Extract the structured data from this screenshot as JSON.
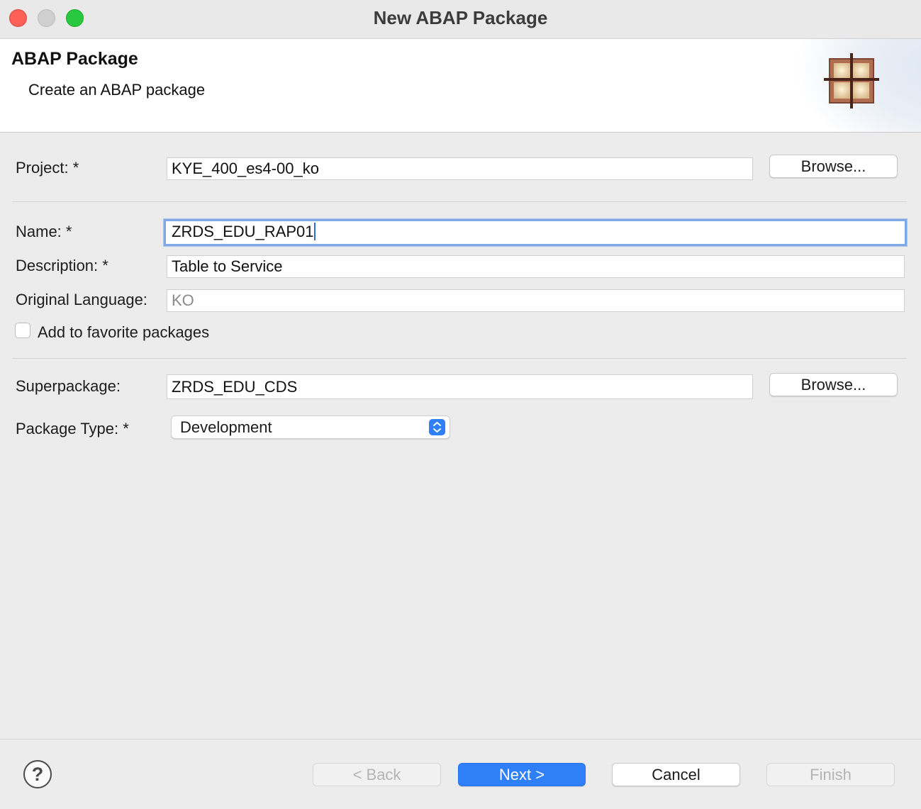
{
  "window": {
    "title": "New ABAP Package"
  },
  "header": {
    "title": "ABAP Package",
    "subtitle": "Create an ABAP package",
    "icon": "package-icon"
  },
  "form": {
    "project": {
      "label": "Project: *",
      "value": "KYE_400_es4-00_ko",
      "browse_label": "Browse..."
    },
    "name": {
      "label": "Name: *",
      "value": "ZRDS_EDU_RAP01"
    },
    "description": {
      "label": "Description: *",
      "value": "Table to Service"
    },
    "original_language": {
      "label": "Original Language:",
      "value": "KO"
    },
    "favorite": {
      "label": "Add to favorite packages",
      "checked": false
    },
    "superpackage": {
      "label": "Superpackage:",
      "value": "ZRDS_EDU_CDS",
      "browse_label": "Browse..."
    },
    "package_type": {
      "label": "Package Type: *",
      "selected": "Development"
    }
  },
  "footer": {
    "help_icon": "question-mark-icon",
    "back_label": "< Back",
    "next_label": "Next >",
    "cancel_label": "Cancel",
    "finish_label": "Finish"
  },
  "colors": {
    "accent": "#2f7ff7",
    "close": "#fe5f57",
    "maximize": "#28c840",
    "focus_ring": "#7fa9e6"
  }
}
